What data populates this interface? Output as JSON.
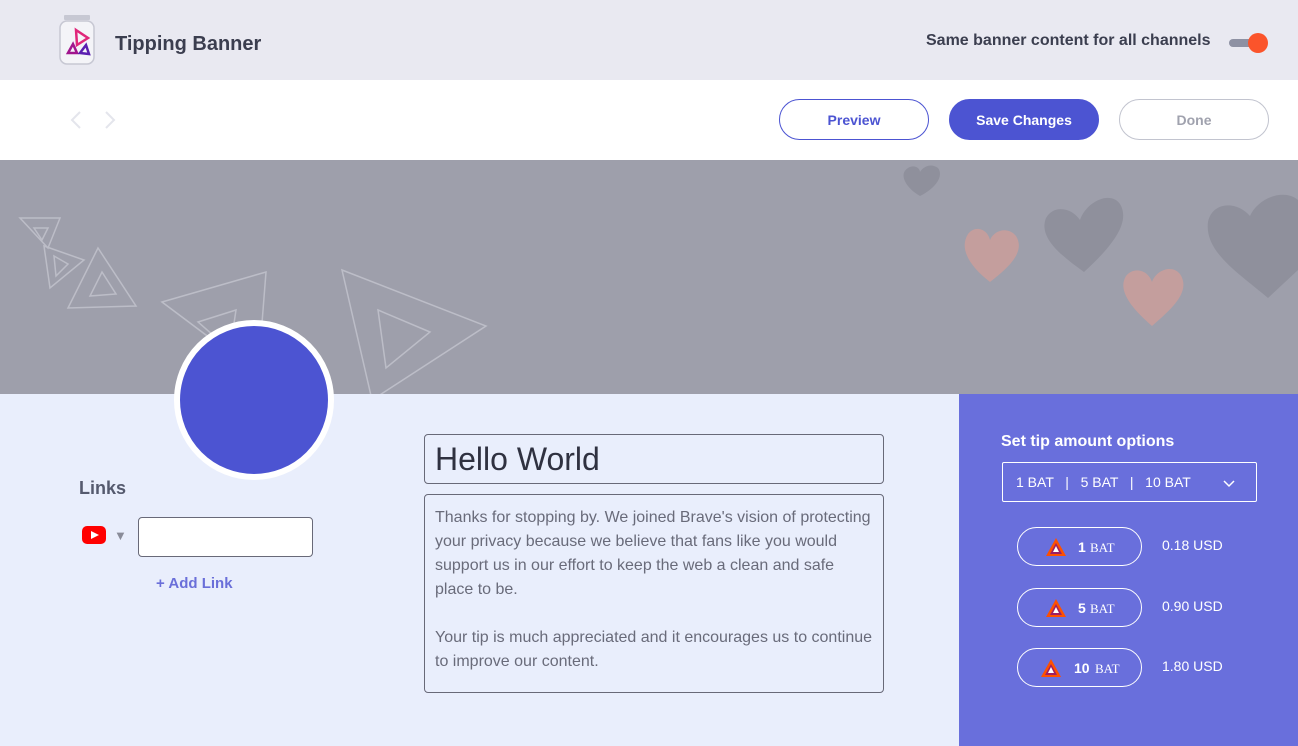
{
  "header": {
    "title": "Tipping Banner",
    "same_content_label": "Same banner content for all channels",
    "same_content_toggle_on": true,
    "toggle_color": "#fb542b"
  },
  "toolbar": {
    "preview_label": "Preview",
    "save_label": "Save Changes",
    "done_label": "Done"
  },
  "colors": {
    "accent": "#4c54d2",
    "tip_panel": "#696fdc",
    "banner": "#9e9fab",
    "content_bg": "#e9eefc"
  },
  "links": {
    "title": "Links",
    "channel_icon": "youtube-icon",
    "link_value": "",
    "add_link_label": "+ Add Link"
  },
  "content": {
    "headline": "Hello World",
    "description_p1": "Thanks for stopping by. We joined Brave's vision of protecting your privacy because we believe that fans like you would support us in our effort to keep the web a clean and safe place to be.",
    "description_p2": "Your tip is much appreciated and it encourages us to continue to improve our content."
  },
  "tips": {
    "title": "Set tip amount options",
    "selected_option": "1 BAT   |   5 BAT   |   10 BAT",
    "amounts": [
      {
        "amount": "1",
        "unit": "BAT",
        "usd": "0.18 USD"
      },
      {
        "amount": "5",
        "unit": "BAT",
        "usd": "0.90 USD"
      },
      {
        "amount": "10",
        "unit": "BAT",
        "usd": "1.80 USD"
      }
    ]
  }
}
